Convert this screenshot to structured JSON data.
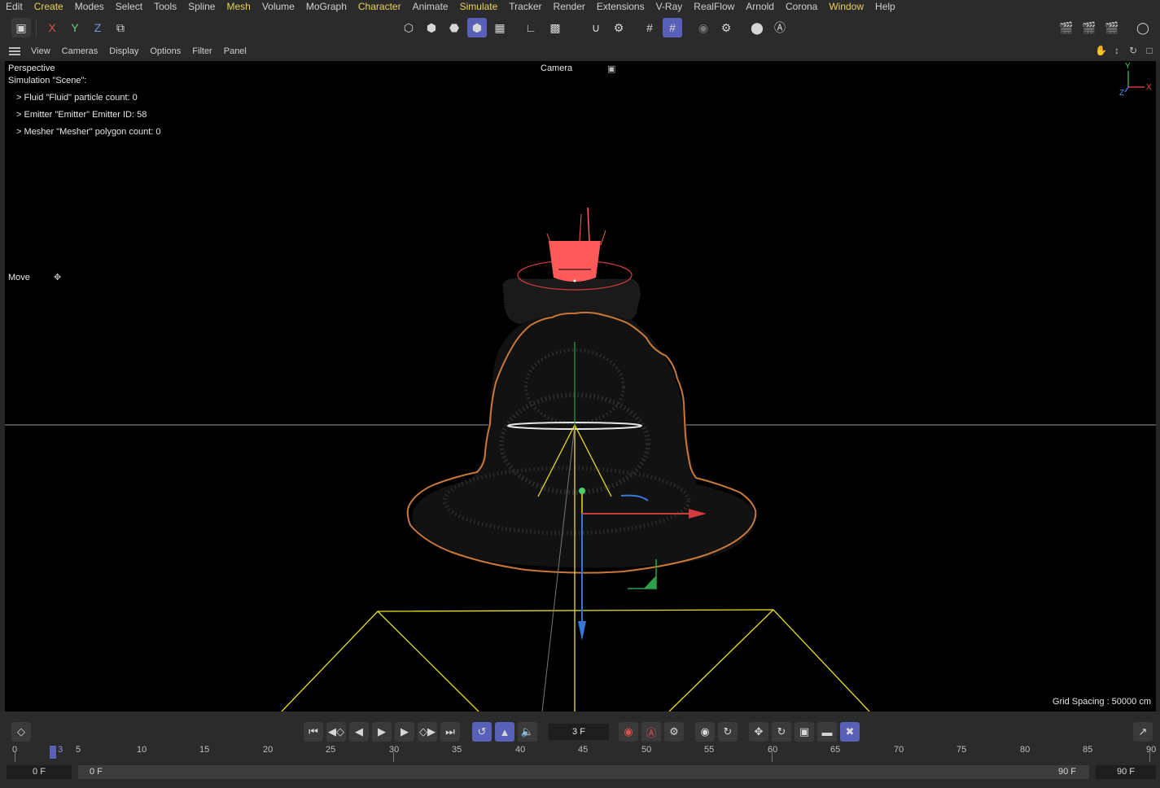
{
  "menubar": {
    "items": [
      "Edit",
      "Create",
      "Modes",
      "Select",
      "Tools",
      "Spline",
      "Mesh",
      "Volume",
      "MoGraph",
      "Character",
      "Animate",
      "Simulate",
      "Tracker",
      "Render",
      "Extensions",
      "V-Ray",
      "RealFlow",
      "Arnold",
      "Corona",
      "Window",
      "Help"
    ],
    "highlighted": [
      "Create",
      "Mesh",
      "Character",
      "Simulate",
      "Window"
    ]
  },
  "toolbar": {
    "axis_x": "X",
    "axis_y": "Y",
    "axis_z": "Z"
  },
  "viewport_menu": {
    "items": [
      "View",
      "Cameras",
      "Display",
      "Options",
      "Filter",
      "Panel"
    ]
  },
  "viewport": {
    "view_name": "Perspective",
    "camera_label": "Camera",
    "sim_title": "Simulation \"Scene\":",
    "sim_lines": [
      "> Fluid \"Fluid\" particle count: 0",
      "> Emitter \"Emitter\" Emitter ID: 58",
      "> Mesher \"Mesher\" polygon count: 0"
    ],
    "tool_label": "Move",
    "grid_spacing": "Grid Spacing : 50000 cm",
    "axis_y": "Y",
    "axis_x": "X",
    "axis_z": "Z"
  },
  "timeline": {
    "current_frame": "3 F",
    "ruler_labels": [
      "0",
      "3",
      "5",
      "10",
      "15",
      "20",
      "25",
      "30",
      "35",
      "40",
      "45",
      "50",
      "55",
      "60",
      "65",
      "70",
      "75",
      "80",
      "85",
      "90"
    ],
    "range_start": "0 F",
    "range_start_inner": "0 F",
    "range_end_inner": "90 F",
    "range_end": "90 F"
  },
  "colors": {
    "accent": "#5860b8",
    "highlight_menu": "#e8d35a",
    "selection_outline": "#c8783a",
    "emitter": "#ff5a5a",
    "camera_frustum": "#e8e020"
  }
}
